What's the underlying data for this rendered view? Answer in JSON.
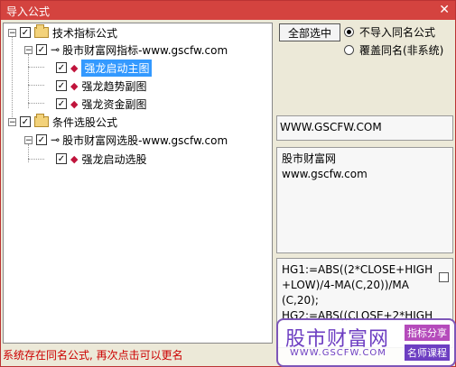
{
  "window": {
    "title": "导入公式",
    "close_glyph": "✕"
  },
  "tree": {
    "group1": {
      "label": "技术指标公式",
      "toggle": "−",
      "checked": "✓"
    },
    "group1_sub": {
      "label": "股市财富网指标-www.gscfw.com",
      "toggle": "−",
      "checked": "✓"
    },
    "item1": {
      "label": "强龙启动主图",
      "checked": "✓"
    },
    "item2": {
      "label": "强龙趋势副图",
      "checked": "✓"
    },
    "item3": {
      "label": "强龙资金副图",
      "checked": "✓"
    },
    "group2": {
      "label": "条件选股公式",
      "toggle": "−",
      "checked": "✓"
    },
    "group2_sub": {
      "label": "股市财富网选股-www.gscfw.com",
      "toggle": "−",
      "checked": "✓"
    },
    "item4": {
      "label": "强龙启动选股",
      "checked": "✓"
    }
  },
  "actions": {
    "select_all": "全部选中",
    "radio1": "不导入同名公式",
    "radio2": "覆盖同名(非系统)"
  },
  "info": {
    "url": "WWW.GSCFW.COM",
    "desc_line1": "股市财富网",
    "desc_line2": "www.gscfw.com",
    "code_line1": "HG1:=ABS((2*CLOSE+HIGH",
    "code_line2": "+LOW)/4-MA(C,20))/MA",
    "code_line3": "(C,20);",
    "code_line4": "HG2:=ABS((CLOSE+2*HIGH"
  },
  "status": "系统存在同名公式, 再次点击可以更名",
  "watermark": {
    "name": "股市财富网",
    "url": "WWW.GSCFW.COM",
    "tag1": "指标分享",
    "tag2": "名师课程"
  },
  "colors": {
    "title_bar": "#d4433f",
    "selection": "#3399ff",
    "status_text": "#cc0000",
    "watermark": "#6d3ec2"
  },
  "icons": {
    "folder": "folder-icon",
    "formula_group": "key-icon",
    "formula_item": "diamond-icon"
  }
}
